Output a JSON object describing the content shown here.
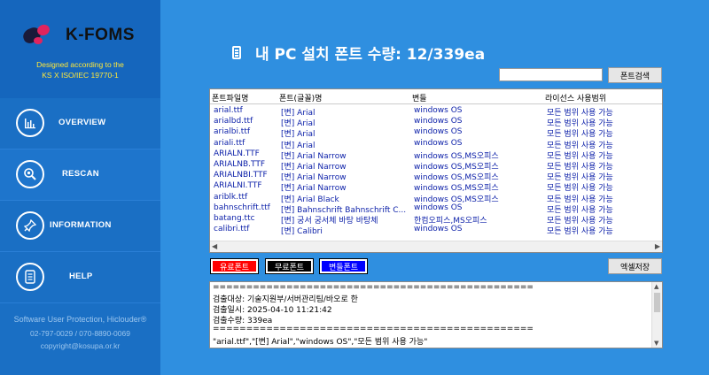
{
  "sidebar": {
    "logo_text": "K-FOMS",
    "tagline1": "Designed according to the",
    "tagline2": "KS X ISO/IEC 19770-1",
    "nav": {
      "overview": "OVERVIEW",
      "rescan": "RESCAN",
      "information": "INFORMATION",
      "help": "HELP"
    },
    "footer1": "Software User Protection, Hiclouder®",
    "footer2": "02-797-0029 / 070-8890-0069",
    "footer3": "copyright@kosupa.or.kr"
  },
  "header": {
    "title": "내 PC 설치 폰트 수량: 12/339ea"
  },
  "search": {
    "placeholder": "",
    "button_label": "폰트검색"
  },
  "table": {
    "columns": [
      "폰트파일명",
      "폰트(글꼴)명",
      "변들",
      "라이선스 사용범위"
    ],
    "rows": [
      [
        "arial.ttf",
        "[변] Arial",
        "windows OS",
        "모든 범위 사용 가능"
      ],
      [
        "arialbd.ttf",
        "[변] Arial",
        "windows OS",
        "모든 범위 사용 가능"
      ],
      [
        "arialbi.ttf",
        "[변] Arial",
        "windows OS",
        "모든 범위 사용 가능"
      ],
      [
        "ariali.ttf",
        "[변] Arial",
        "windows OS",
        "모든 범위 사용 가능"
      ],
      [
        "ARIALN.TTF",
        "[변] Arial Narrow",
        "windows OS,MS오피스",
        "모든 범위 사용 가능"
      ],
      [
        "ARIALNB.TTF",
        "[변] Arial Narrow",
        "windows OS,MS오피스",
        "모든 범위 사용 가능"
      ],
      [
        "ARIALNBI.TTF",
        "[변] Arial Narrow",
        "windows OS,MS오피스",
        "모든 범위 사용 가능"
      ],
      [
        "ARIALNI.TTF",
        "[변] Arial Narrow",
        "windows OS,MS오피스",
        "모든 범위 사용 가능"
      ],
      [
        "ariblk.ttf",
        "[변] Arial Black",
        "windows OS,MS오피스",
        "모든 범위 사용 가능"
      ],
      [
        "bahnschrift.ttf",
        "[변] Bahnschrift Bahnschrift C...",
        "windows OS",
        "모든 범위 사용 가능"
      ],
      [
        "batang.ttc",
        "[변] 궁서 궁서체 바탕 바탕체",
        "한컴오피스,MS오피스",
        "모든 범위 사용 가능"
      ],
      [
        "calibri.ttf",
        "[변] Calibri",
        "windows OS",
        "모든 범위 사용 가능"
      ]
    ]
  },
  "legend": {
    "paid": "유료폰트",
    "free": "무료폰트",
    "variant": "변들폰트"
  },
  "excel_button": "엑셀저장",
  "log": {
    "separator": "================================================",
    "target": "검출대상: 기술지원부/서버관리팀/바오로 한",
    "date": "검출일시: 2025-04-10 11:21:42",
    "count": "검출수량: 339ea",
    "first_record": "\"arial.ttf\",\"[변] Arial\",\"windows OS\",\"모든 범위 사용 가능\""
  },
  "colors": {
    "background": "#2f8fe0",
    "sidebar": "#1a6fc4",
    "row_text": "#0a1ea8",
    "paid": "#ff0000",
    "free": "#000000",
    "variant": "#0000ff",
    "tagline": "#ffe83a"
  }
}
